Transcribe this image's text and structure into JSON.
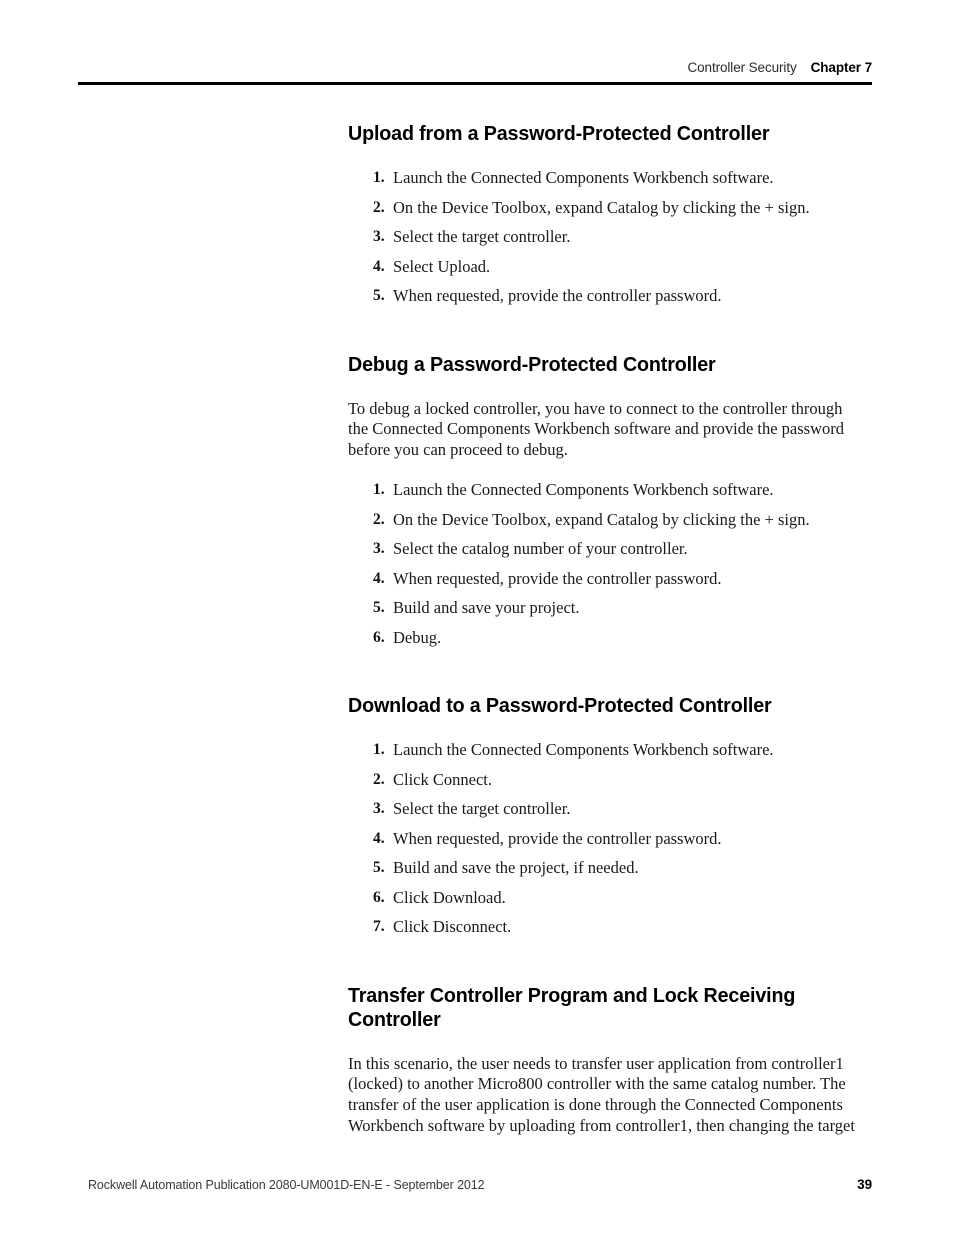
{
  "header": {
    "section_title": "Controller Security",
    "chapter_label": "Chapter 7"
  },
  "sections": [
    {
      "heading": "Upload from a Password-Protected Controller",
      "paragraphs": [],
      "steps": [
        "Launch the Connected Components Workbench software.",
        "On the Device Toolbox, expand Catalog by clicking the + sign.",
        "Select the target controller.",
        "Select Upload.",
        "When requested, provide the controller password."
      ]
    },
    {
      "heading": "Debug a Password-Protected Controller",
      "paragraphs": [
        "To debug a locked controller, you have to connect to the controller through the Connected Components Workbench software and provide the password before you can proceed to debug."
      ],
      "steps": [
        "Launch the Connected Components Workbench software.",
        "On the Device Toolbox, expand Catalog by clicking the + sign.",
        "Select the catalog number of your controller.",
        "When requested, provide the controller password.",
        "Build and save your project.",
        "Debug."
      ]
    },
    {
      "heading": "Download to a Password-Protected Controller",
      "paragraphs": [],
      "steps": [
        "Launch the Connected Components Workbench software.",
        "Click Connect.",
        "Select the target controller.",
        "When requested, provide the controller password.",
        "Build and save the project, if needed.",
        "Click Download.",
        "Click Disconnect."
      ]
    },
    {
      "heading": "Transfer Controller Program and Lock Receiving Controller",
      "paragraphs": [
        "In this scenario, the user needs to transfer user application from controller1 (locked) to another Micro800 controller with the same catalog number. The transfer of the user application is done through the Connected Components Workbench software by uploading from controller1, then changing the target"
      ],
      "steps": []
    }
  ],
  "step_numbers": [
    "1.",
    "2.",
    "3.",
    "4.",
    "5.",
    "6.",
    "7."
  ],
  "footer": {
    "publication": "Rockwell Automation Publication 2080-UM001D-EN-E - September 2012",
    "page_number": "39"
  },
  "colors": {
    "text": "#1a1a1a",
    "rule": "#000000",
    "background": "#ffffff"
  }
}
